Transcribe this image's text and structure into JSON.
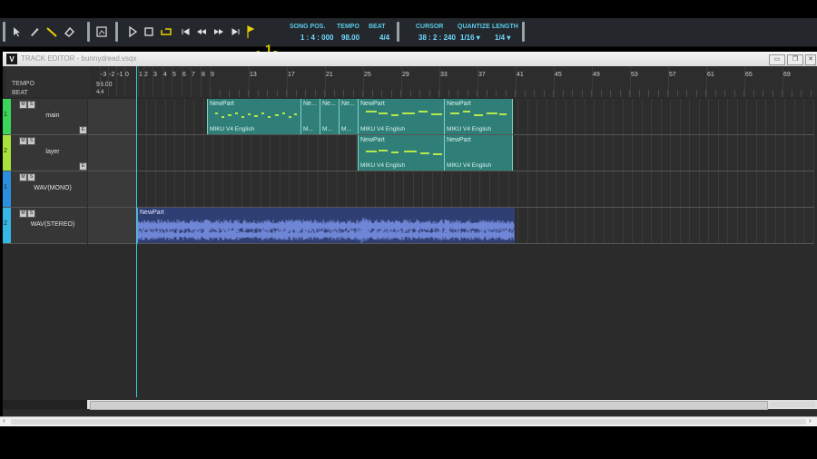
{
  "toolbar": {
    "tools": [
      {
        "name": "pointer-tool-icon"
      },
      {
        "name": "pencil-tool-icon"
      },
      {
        "name": "line-tool-icon"
      },
      {
        "name": "eraser-tool-icon"
      }
    ],
    "song_pos_label": "SONG POS.",
    "song_pos_value": "1 : 4 : 000",
    "tempo_label": "TEMPO",
    "tempo_value": "98.00",
    "beat_label": "BEAT",
    "beat_value": "4/4",
    "cursor_label": "CURSOR",
    "cursor_value": "38 : 2 : 240",
    "quantize_label": "QUANTIZE",
    "quantize_value": "1/16 ▾",
    "length_label": "LENGTH",
    "length_value": "1/4 ▾",
    "start_marker": "S",
    "end_marker": "E",
    "start_marker_num": "1",
    "colors": {
      "accent": "#59c9e8",
      "marker": "#e8d000"
    }
  },
  "window": {
    "icon": "V",
    "title": "TRACK EDITOR - bunnydread.vsqx"
  },
  "header": {
    "tempo_label": "TEMPO",
    "beat_label": "BEAT",
    "tempo_value": "98.00",
    "beat_value": "4/4"
  },
  "ruler": {
    "labels": [
      "-3",
      "-2",
      "-1",
      "0",
      "1",
      "2",
      "3",
      "4",
      "5",
      "6",
      "7",
      "8",
      "9",
      "13",
      "17",
      "21",
      "25",
      "29",
      "33",
      "37",
      "41",
      "45",
      "49",
      "53",
      "57",
      "61",
      "65",
      "69"
    ]
  },
  "tracks": [
    {
      "num": "1",
      "name": "main",
      "color": "#3ad65a"
    },
    {
      "num": "2",
      "name": "layer",
      "color": "#a7e23a"
    },
    {
      "num": "1",
      "name": "WAV(MONO)",
      "color": "#2b8fe0"
    },
    {
      "num": "2",
      "name": "WAV(STEREO)",
      "color": "#35b8e6"
    }
  ],
  "parts": {
    "main": [
      {
        "name": "NewPart",
        "foot": "MIKU  V4  English"
      },
      {
        "name": "Ne...",
        "foot": "M..."
      },
      {
        "name": "Ne...",
        "foot": "M..."
      },
      {
        "name": "Ne...",
        "foot": "M..."
      },
      {
        "name": "NewPart",
        "foot": "MIKU  V4  English"
      },
      {
        "name": "NewPart",
        "foot": "MIKU  V4  English"
      }
    ],
    "layer": [
      {
        "name": "NewPart",
        "foot": "MIKU  V4  English"
      },
      {
        "name": "NewPart",
        "foot": "MIKU  V4  English"
      }
    ],
    "wav": {
      "name": "NewPart"
    }
  }
}
